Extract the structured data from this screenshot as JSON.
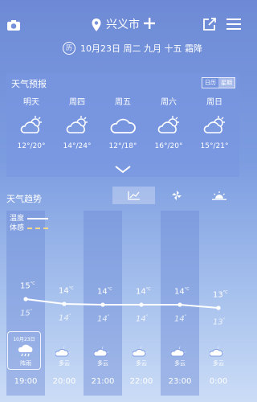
{
  "header": {
    "city": "兴义市",
    "date_line": "10月23日 周二  九月 十五 霜降",
    "almanac_badge": "历"
  },
  "forecast": {
    "title": "天气预报",
    "toggle": [
      "日历",
      "星期"
    ],
    "days": [
      {
        "name": "明天",
        "icon": "partly-sunny-icon",
        "temp": "12°/20°"
      },
      {
        "name": "周四",
        "icon": "partly-sunny-icon",
        "temp": "14°/24°"
      },
      {
        "name": "周五",
        "icon": "cloud-icon",
        "temp": "12°/18°"
      },
      {
        "name": "周六",
        "icon": "partly-sunny-icon",
        "temp": "16°/20°"
      },
      {
        "name": "周日",
        "icon": "partly-sunny-icon",
        "temp": "15°/21°"
      }
    ]
  },
  "trend": {
    "title": "天气趋势",
    "legend": {
      "temp": "温度",
      "feel": "体感"
    },
    "selected_date": "10月23日",
    "hours": [
      {
        "time": "19:00",
        "hi": "15",
        "lo": "15",
        "cond": "阵雨",
        "icon": "rain-cloud-icon"
      },
      {
        "time": "20:00",
        "hi": "14",
        "lo": "14",
        "cond": "多云",
        "icon": "moon-cloud-icon"
      },
      {
        "time": "21:00",
        "hi": "14",
        "lo": "14",
        "cond": "多云",
        "icon": "moon-cloud-icon"
      },
      {
        "time": "22:00",
        "hi": "14",
        "lo": "14",
        "cond": "多云",
        "icon": "moon-cloud-icon"
      },
      {
        "time": "23:00",
        "hi": "14",
        "lo": "14",
        "cond": "多云",
        "icon": "moon-cloud-icon"
      },
      {
        "time": "0:00",
        "hi": "13",
        "lo": "13",
        "cond": "多云",
        "icon": "moon-cloud-icon"
      }
    ]
  },
  "colors": {
    "bg_top": "#6e8ad6",
    "bg_bottom": "#cbdcf6",
    "feel_line": "#f5d98a"
  }
}
